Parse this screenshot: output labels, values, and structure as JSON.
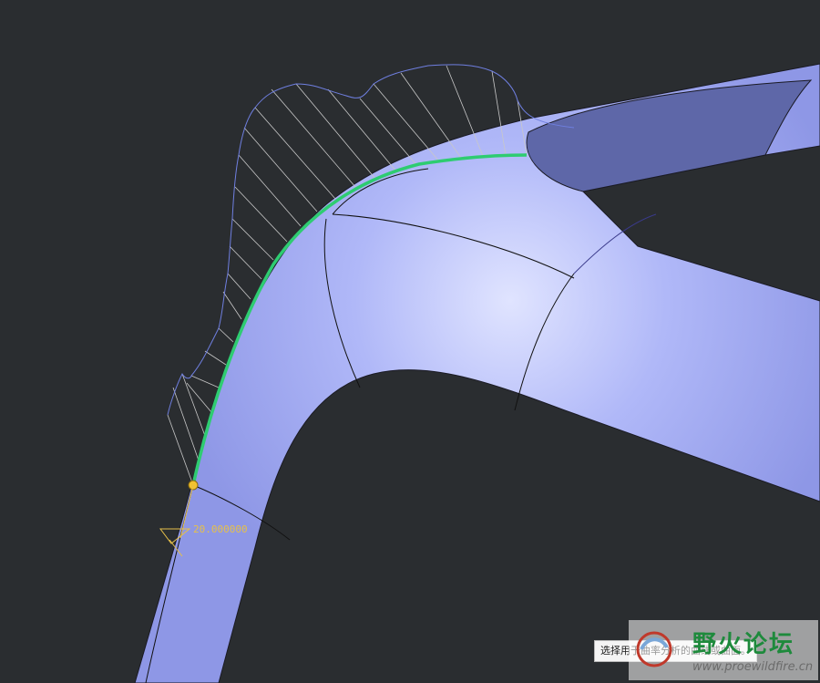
{
  "viewport": {
    "background": "#2a2d30"
  },
  "surface": {
    "fill": "#a8b0f4",
    "highlight": "#d8dcff",
    "edge": "#1a1a24"
  },
  "analysis": {
    "curve_color": "#2ecc71",
    "comb_color": "#6f7fe0",
    "hair_color": "#c8c8c8"
  },
  "dimension": {
    "value": "20.000000",
    "color": "#e6c04a"
  },
  "tooltip": {
    "text": "选择用于曲率分析的曲线或曲面。"
  },
  "watermark": {
    "title": "野火论坛",
    "url": "www.proewildfire.cn",
    "accent": "#1e8a3c"
  }
}
